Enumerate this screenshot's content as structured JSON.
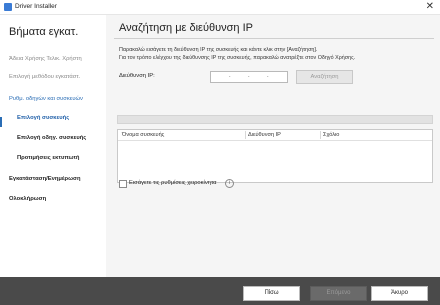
{
  "window": {
    "title": "Driver Installer",
    "close_glyph": "✕"
  },
  "sidebar": {
    "title": "Βήματα εγκατ.",
    "items": [
      {
        "label": "Άδεια Χρήσης Τελικ. Χρήστη",
        "state": "done"
      },
      {
        "label": "Επιλογή μεθόδου εγκατάστ.",
        "state": "done"
      },
      {
        "label": "Ρυθμ. οδηγών και συσκευών",
        "state": "current-parent"
      },
      {
        "label": "Επιλογή συσκευής",
        "state": "active"
      },
      {
        "label": "Επιλογή οδηγ. συσκευής",
        "state": "pending"
      },
      {
        "label": "Προτιμήσεις εκτυπωτή",
        "state": "pending"
      },
      {
        "label": "Εγκατάσταση/Ενημέρωση",
        "state": "pending"
      },
      {
        "label": "Ολοκλήρωση",
        "state": "pending"
      }
    ]
  },
  "main": {
    "title": "Αναζήτηση με διεύθυνση IP",
    "instructions": [
      "Παρακαλώ εισάγετε τη διεύθυνση IP της συσκευής και κάντε κλικ στην [Αναζήτηση].",
      "Για τον τρόπο ελέγχου της διεύθυνσης IP της συσκευής, παρακαλώ ανατρέξτε στον Οδηγό Χρήσης."
    ],
    "ip_label": "Διεύθυνση IP:",
    "ip_dot": ".",
    "search_button": "Αναζήτηση",
    "progress_fraction": 0.0,
    "table_columns": [
      "Όνομα συσκευής",
      "Διεύθυνση IP",
      "Σχόλιο"
    ],
    "table_rows": [],
    "checkbox_label": "Εισάγετε τις ρυθμίσεις χειροκίνητα",
    "checkbox_checked": false,
    "info_glyph": "i"
  },
  "footer": {
    "back": "Πίσω",
    "next": "Επόμενο",
    "cancel": "Άκυρο"
  },
  "colors": {
    "accent": "#2a6db5",
    "footer_bg": "#4a4a4a"
  }
}
